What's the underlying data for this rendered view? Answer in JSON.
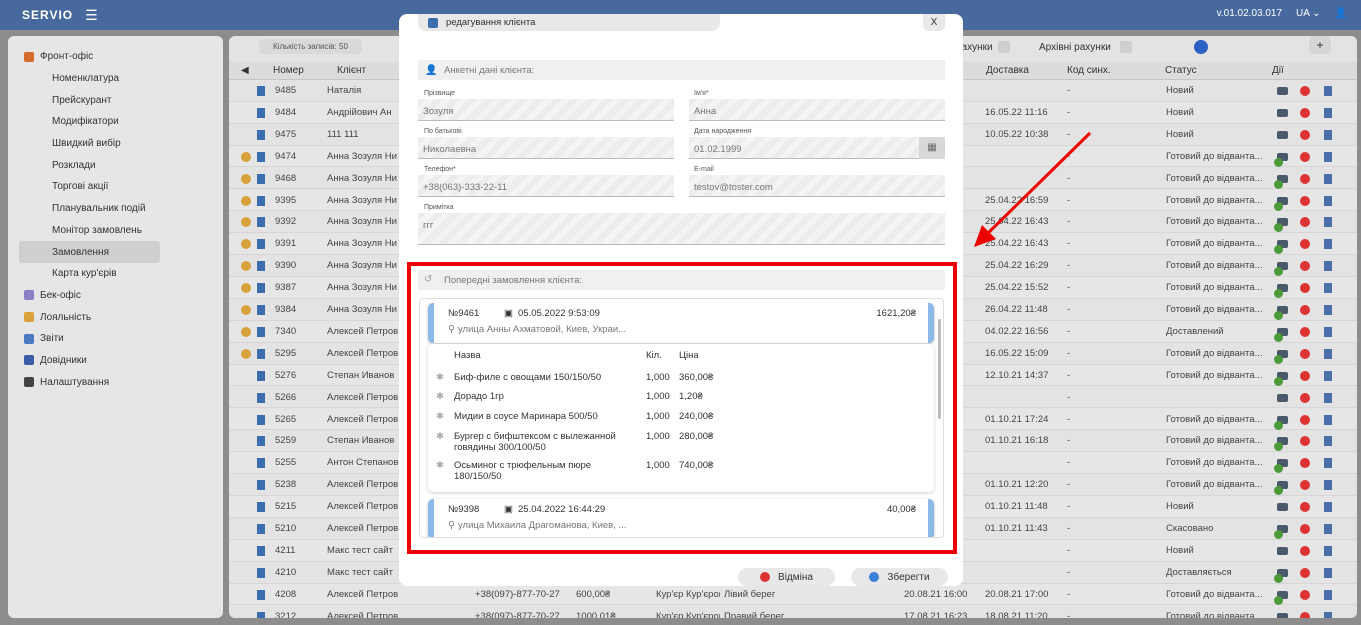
{
  "topbar": {
    "logo": "SERVIO",
    "version": "v.01.02.03.017",
    "lang": "UA ⌄"
  },
  "sidebar": {
    "items": [
      {
        "label": "Фронт-офіс",
        "level": 0,
        "color": "#d66a2a"
      },
      {
        "label": "Номенклатура",
        "level": 1
      },
      {
        "label": "Прейскурант",
        "level": 1
      },
      {
        "label": "Модифікатори",
        "level": 1
      },
      {
        "label": "Швидкий вибір",
        "level": 1
      },
      {
        "label": "Розклади",
        "level": 1
      },
      {
        "label": "Торгові акції",
        "level": 1
      },
      {
        "label": "Планувальник подій",
        "level": 1
      },
      {
        "label": "Монітор замовлень",
        "level": 1
      },
      {
        "label": "Замовлення",
        "level": 1,
        "active": true
      },
      {
        "label": "Карта кур'єрів",
        "level": 1
      },
      {
        "label": "Бек-офіс",
        "level": 0,
        "color": "#8b7fc7"
      },
      {
        "label": "Лояльність",
        "level": 0,
        "color": "#d9a23a"
      },
      {
        "label": "Звіти",
        "level": 0,
        "color": "#4a7ac2"
      },
      {
        "label": "Довідники",
        "level": 0,
        "color": "#3b5ba8"
      },
      {
        "label": "Налаштування",
        "level": 0,
        "color": "#444"
      }
    ]
  },
  "main": {
    "records_label": "Кількість записів: 50",
    "tab_accounts": "рахунки",
    "tab_archive": "Архівні рахунки",
    "add_label": "+",
    "columns": {
      "number": "Номер",
      "client": "Клієнт",
      "delivery": "Доставка",
      "sync": "Код синх.",
      "status": "Статус",
      "actions": "Дії"
    },
    "rows": [
      {
        "coin": false,
        "num": "9485",
        "client": "Наталія",
        "delivery": "",
        "sync": "-",
        "status": "Новий"
      },
      {
        "coin": false,
        "num": "9484",
        "client": "Андрійович Ан",
        "delivery": "16.05.22 11:16",
        "sync": "-",
        "status": "Новий"
      },
      {
        "coin": false,
        "num": "9475",
        "client": "111 111",
        "delivery": "10.05.22 10:38",
        "sync": "-",
        "status": "Новий"
      },
      {
        "coin": true,
        "num": "9474",
        "client": "Анна Зозуля Ни",
        "delivery": "",
        "sync": "-",
        "status": "Готовий до відванта..."
      },
      {
        "coin": true,
        "num": "9468",
        "client": "Анна Зозуля Ни",
        "delivery": "",
        "sync": "-",
        "status": "Готовий до відванта..."
      },
      {
        "coin": true,
        "num": "9395",
        "client": "Анна Зозуля Ни",
        "delivery": "25.04.22 16:59",
        "sync": "-",
        "status": "Готовий до відванта..."
      },
      {
        "coin": true,
        "num": "9392",
        "client": "Анна Зозуля Ни",
        "delivery": "25.04.22 16:43",
        "sync": "-",
        "status": "Готовий до відванта..."
      },
      {
        "coin": true,
        "num": "9391",
        "client": "Анна Зозуля Ни",
        "delivery": "25.04.22 16:43",
        "sync": "-",
        "status": "Готовий до відванта..."
      },
      {
        "coin": true,
        "num": "9390",
        "client": "Анна Зозуля Ни",
        "delivery": "25.04.22 16:29",
        "sync": "-",
        "status": "Готовий до відванта..."
      },
      {
        "coin": true,
        "num": "9387",
        "client": "Анна Зозуля Ни",
        "delivery": "25.04.22 15:52",
        "sync": "-",
        "status": "Готовий до відванта..."
      },
      {
        "coin": true,
        "num": "9384",
        "client": "Анна Зозуля Ни",
        "delivery": "26.04.22 11:48",
        "sync": "-",
        "status": "Готовий до відванта..."
      },
      {
        "coin": true,
        "num": "7340",
        "client": "Алексей Петров",
        "delivery": "04.02.22 16:56",
        "sync": "-",
        "status": "Доставлений"
      },
      {
        "coin": true,
        "num": "5295",
        "client": "Алексей Петров",
        "delivery": "16.05.22 15:09",
        "sync": "-",
        "status": "Готовий до відванта..."
      },
      {
        "coin": false,
        "num": "5276",
        "client": "Степан Иванов",
        "delivery": "12.10.21 14:37",
        "sync": "-",
        "status": "Готовий до відванта..."
      },
      {
        "coin": false,
        "num": "5266",
        "client": "Алексей Петров",
        "delivery": "",
        "sync": "-",
        "status": ""
      },
      {
        "coin": false,
        "num": "5265",
        "client": "Алексей Петров",
        "delivery": "01.10.21 17:24",
        "sync": "-",
        "status": "Готовий до відванта..."
      },
      {
        "coin": false,
        "num": "5259",
        "client": "Степан Иванов",
        "delivery": "01.10.21 16:18",
        "sync": "-",
        "status": "Готовий до відванта..."
      },
      {
        "coin": false,
        "num": "5255",
        "client": "Антон Степанов",
        "delivery": "",
        "sync": "-",
        "status": "Готовий до відванта..."
      },
      {
        "coin": false,
        "num": "5238",
        "client": "Алексей Петров",
        "delivery": "01.10.21 12:20",
        "sync": "-",
        "status": "Готовий до відванта..."
      },
      {
        "coin": false,
        "num": "5215",
        "client": "Алексей Петров",
        "delivery": "01.10.21 11:48",
        "sync": "-",
        "status": "Новий"
      },
      {
        "coin": false,
        "num": "5210",
        "client": "Алексей Петров",
        "delivery": "01.10.21 11:43",
        "sync": "-",
        "status": "Скасовано"
      },
      {
        "coin": false,
        "num": "4211",
        "client": "Макс тест сайт",
        "delivery": "",
        "sync": "-",
        "status": "Новий"
      },
      {
        "coin": false,
        "num": "4210",
        "client": "Макс тест сайт",
        "delivery": "",
        "sync": "-",
        "status": "Доставляється"
      },
      {
        "coin": false,
        "num": "4208",
        "client": "Алексей Петров",
        "delivery": "20.08.21 17:00",
        "sync": "-",
        "status": "Готовий до відванта...",
        "phone": "+38(097)-877-70-27",
        "sum": "600,00₴",
        "courier": "Кур'єр Кур'єрові",
        "bank": "Лівий берег",
        "date2": "20.08.21 16:00"
      },
      {
        "coin": false,
        "num": "3212",
        "client": "Алексей Петров",
        "delivery": "18.08.21 11:20",
        "sync": "-",
        "status": "Готовий до відванта...",
        "phone": "+38(097)-877-70-27",
        "sum": "1000,01₴",
        "courier": "Кур'єр Кур'єрові",
        "bank": "Правий берег",
        "date2": "17.08.21 16:23"
      }
    ]
  },
  "modal": {
    "title": "редагування клієнта",
    "close": "X",
    "profile_section": "Анкетні дані клієнта:",
    "fields": {
      "surname_label": "Прізвище",
      "surname": "Зозуля",
      "name_label": "Ім'я*",
      "name": "Анна",
      "patronymic_label": "По батькові",
      "patronymic": "Николаевна",
      "birth_label": "Дата народження",
      "birth": "01.02.1999",
      "phone_label": "Телефон*",
      "phone": "+38(063)-333-22-11",
      "email_label": "E-mail",
      "email": "testov@toster.com",
      "note_label": "Примітка",
      "note": "ггг"
    },
    "history_section": "Попередні замовлення клієнта:",
    "orders": [
      {
        "num": "№9461",
        "date": "05.05.2022 9:53:09",
        "sum": "1621,20₴",
        "address": "улица Анны Ахматовой, Киев, Украи...",
        "items_header": {
          "name": "Назва",
          "qty": "Кіл.",
          "price": "Ціна"
        },
        "items": [
          {
            "name": "Биф-филе с овощами 150/150/50",
            "qty": "1,000",
            "price": "360,00₴"
          },
          {
            "name": "Дорадо 1гр",
            "qty": "1,000",
            "price": "1,20₴"
          },
          {
            "name": "Мидии в соусе Маринара 500/50",
            "qty": "1,000",
            "price": "240,00₴"
          },
          {
            "name": "Бургер с бифштексом с вылежанной говядины 300/100/50",
            "qty": "1,000",
            "price": "280,00₴"
          },
          {
            "name": "Осьминог с трюфельным пюре 180/150/50",
            "qty": "1,000",
            "price": "740,00₴"
          }
        ]
      },
      {
        "num": "№9398",
        "date": "25.04.2022 16:44:29",
        "sum": "40,00₴",
        "address": "улица Михаила Драгоманова, Киев, ..."
      }
    ],
    "cancel_label": "Відміна",
    "save_label": "Зберегти"
  }
}
